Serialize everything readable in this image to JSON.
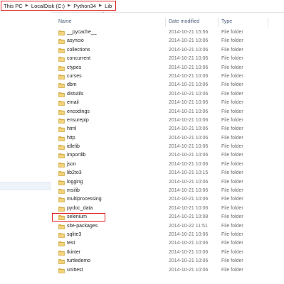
{
  "address_bar": {
    "breadcrumbs": [
      "This PC",
      "LocalDisk (C:)",
      "Python34",
      "Lib"
    ]
  },
  "columns": {
    "name": "Name",
    "date_modified": "Date modified",
    "type": "Type"
  },
  "colors": {
    "highlight_box": "#e02020",
    "folder": "#e8c15a"
  },
  "files": [
    {
      "name": "__pycache__",
      "date": "2014-10-21 15:56",
      "type": "File folder",
      "icon": "folder-icon"
    },
    {
      "name": "asyncio",
      "date": "2014-10-21 10:06",
      "type": "File folder",
      "icon": "folder-icon"
    },
    {
      "name": "collections",
      "date": "2014-10-21 10:06",
      "type": "File folder",
      "icon": "folder-icon"
    },
    {
      "name": "concurrent",
      "date": "2014-10-21 10:06",
      "type": "File folder",
      "icon": "folder-icon"
    },
    {
      "name": "ctypes",
      "date": "2014-10-21 10:06",
      "type": "File folder",
      "icon": "folder-icon"
    },
    {
      "name": "curses",
      "date": "2014-10-21 10:06",
      "type": "File folder",
      "icon": "folder-icon"
    },
    {
      "name": "dbm",
      "date": "2014-10-21 10:06",
      "type": "File folder",
      "icon": "folder-icon"
    },
    {
      "name": "distutils",
      "date": "2014-10-21 10:06",
      "type": "File folder",
      "icon": "folder-icon"
    },
    {
      "name": "email",
      "date": "2014-10-21 10:06",
      "type": "File folder",
      "icon": "folder-icon"
    },
    {
      "name": "encodings",
      "date": "2014-10-21 10:06",
      "type": "File folder",
      "icon": "folder-icon"
    },
    {
      "name": "ensurepip",
      "date": "2014-10-21 10:06",
      "type": "File folder",
      "icon": "folder-icon"
    },
    {
      "name": "html",
      "date": "2014-10-21 10:06",
      "type": "File folder",
      "icon": "folder-icon"
    },
    {
      "name": "http",
      "date": "2014-10-21 10:06",
      "type": "File folder",
      "icon": "folder-icon"
    },
    {
      "name": "idlelib",
      "date": "2014-10-21 10:06",
      "type": "File folder",
      "icon": "folder-icon"
    },
    {
      "name": "importlib",
      "date": "2014-10-21 10:06",
      "type": "File folder",
      "icon": "folder-icon"
    },
    {
      "name": "json",
      "date": "2014-10-21 10:06",
      "type": "File folder",
      "icon": "folder-icon"
    },
    {
      "name": "lib2to3",
      "date": "2014-10-21 10:15",
      "type": "File folder",
      "icon": "folder-icon"
    },
    {
      "name": "logging",
      "date": "2014-10-21 10:06",
      "type": "File folder",
      "icon": "folder-icon"
    },
    {
      "name": "msilib",
      "date": "2014-10-21 10:06",
      "type": "File folder",
      "icon": "folder-icon"
    },
    {
      "name": "multiprocessing",
      "date": "2014-10-21 10:06",
      "type": "File folder",
      "icon": "folder-icon"
    },
    {
      "name": "pydoc_data",
      "date": "2014-10-21 10:06",
      "type": "File folder",
      "icon": "folder-icon"
    },
    {
      "name": "selenium",
      "date": "2014-10-21 10:08",
      "type": "File folder",
      "icon": "folder-icon",
      "highlighted": true
    },
    {
      "name": "site-packages",
      "date": "2014-10-22 11:51",
      "type": "File folder",
      "icon": "folder-icon"
    },
    {
      "name": "sqlite3",
      "date": "2014-10-21 10:06",
      "type": "File folder",
      "icon": "folder-icon"
    },
    {
      "name": "test",
      "date": "2014-10-21 10:06",
      "type": "File folder",
      "icon": "folder-icon"
    },
    {
      "name": "tkinter",
      "date": "2014-10-21 10:06",
      "type": "File folder",
      "icon": "folder-icon"
    },
    {
      "name": "turtledemo",
      "date": "2014-10-21 10:06",
      "type": "File folder",
      "icon": "folder-icon"
    },
    {
      "name": "unittest",
      "date": "2014-10-21 10:06",
      "type": "File folder",
      "icon": "folder-icon"
    }
  ]
}
